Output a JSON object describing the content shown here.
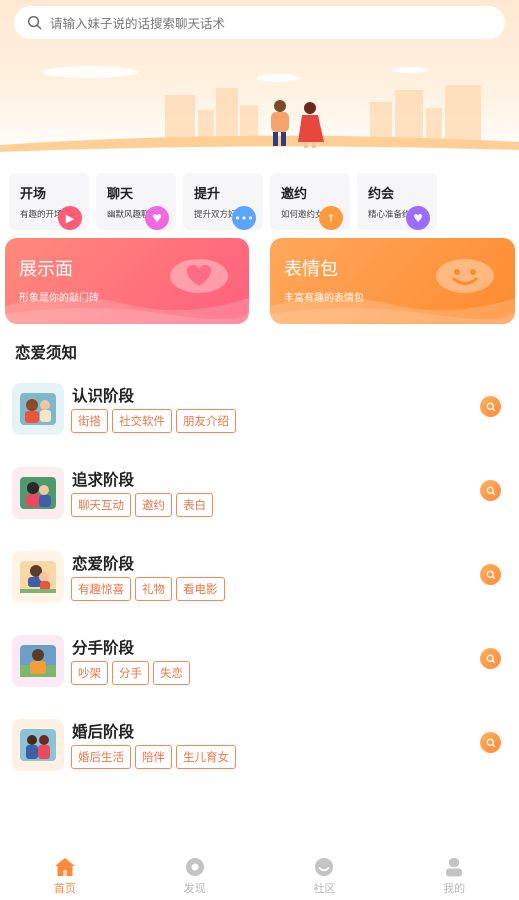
{
  "search": {
    "placeholder": "请输入妹子说的话搜索聊天话术",
    "icon": "search-icon"
  },
  "categories": [
    {
      "title": "开场",
      "subtitle": "有趣的开场白",
      "icon": "play-icon",
      "color": "#ff5c7a"
    },
    {
      "title": "聊天",
      "subtitle": "幽默风趣聊天",
      "icon": "heart-icon",
      "color": "#f06adf"
    },
    {
      "title": "提升",
      "subtitle": "提升双方好感",
      "icon": "chat-dots-icon",
      "color": "#5aa5ff"
    },
    {
      "title": "邀约",
      "subtitle": "如何邀约女生",
      "icon": "arrow-up-icon",
      "color": "#ff9a3c"
    },
    {
      "title": "约会",
      "subtitle": "精心准备约会",
      "icon": "couple-icon",
      "color": "#9a6cff"
    }
  ],
  "feature_cards": [
    {
      "title": "展示面",
      "subtitle": "形象是你的敲门砖",
      "icon": "heart-icon"
    },
    {
      "title": "表情包",
      "subtitle": "丰富有趣的表情包",
      "icon": "smile-icon"
    }
  ],
  "section": {
    "title": "恋爱须知"
  },
  "stages": [
    {
      "name": "认识阶段",
      "tags": [
        "街搭",
        "社交软件",
        "朋友介绍"
      ],
      "thumb_bg": "#e6f4f8"
    },
    {
      "name": "追求阶段",
      "tags": [
        "聊天互动",
        "邀约",
        "表白"
      ],
      "thumb_bg": "#fdecef"
    },
    {
      "name": "恋爱阶段",
      "tags": [
        "有趣惊喜",
        "礼物",
        "看电影"
      ],
      "thumb_bg": "#fff4e6"
    },
    {
      "name": "分手阶段",
      "tags": [
        "吵架",
        "分手",
        "失恋"
      ],
      "thumb_bg": "#fbeaf5"
    },
    {
      "name": "婚后阶段",
      "tags": [
        "婚后生活",
        "陪伴",
        "生儿育女"
      ],
      "thumb_bg": "#fff0e4"
    }
  ],
  "tabs": [
    {
      "label": "首页",
      "icon": "home-icon",
      "active": true
    },
    {
      "label": "发现",
      "icon": "discover-icon",
      "active": false
    },
    {
      "label": "社区",
      "icon": "community-icon",
      "active": false
    },
    {
      "label": "我的",
      "icon": "profile-icon",
      "active": false
    }
  ],
  "colors": {
    "accent": "#ff8a3c",
    "tag_border": "#f08a5a",
    "inactive": "#b9b9b9"
  }
}
